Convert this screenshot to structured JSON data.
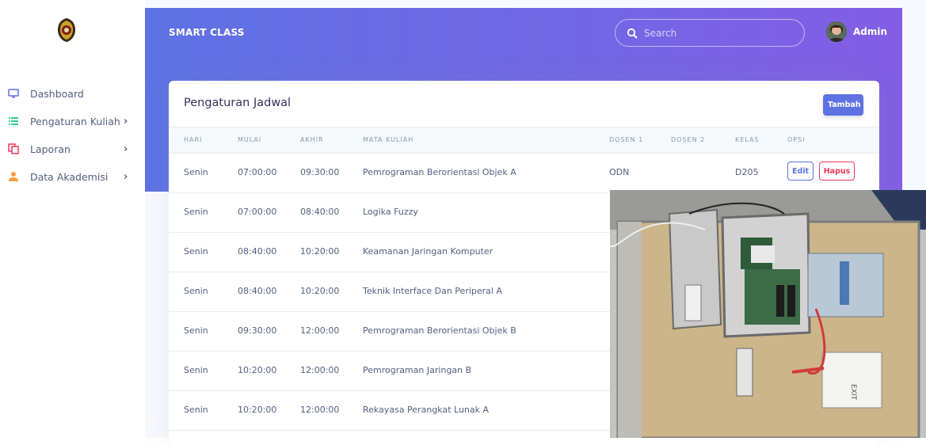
{
  "sidebar": {
    "logo": "university-crest-logo",
    "items": [
      {
        "label": "Dashboard",
        "icon": "monitor-icon",
        "color": "#5e72e4",
        "has_submenu": false
      },
      {
        "label": "Pengaturan Kuliah",
        "icon": "list-icon",
        "color": "#2dce89",
        "has_submenu": true
      },
      {
        "label": "Laporan",
        "icon": "copy-icon",
        "color": "#f5365c",
        "has_submenu": true
      },
      {
        "label": "Data Akademisi",
        "icon": "user-icon",
        "color": "#fb6340",
        "has_submenu": true
      }
    ]
  },
  "header": {
    "brand": "SMART CLASS",
    "search_placeholder": "Search",
    "user_name": "Admin"
  },
  "card": {
    "title": "Pengaturan Jadwal",
    "add_button": "Tambah",
    "columns": [
      "HARI",
      "MULAI",
      "AKHIR",
      "MATA KULIAH",
      "DOSEN 1",
      "DOSEN 2",
      "KELAS",
      "OPSI"
    ],
    "rows": [
      {
        "hari": "Senin",
        "mulai": "07:00:00",
        "akhir": "09:30:00",
        "matkul": "Pemrograman Berorientasi Objek A",
        "dosen1": "ODN",
        "dosen2": "",
        "kelas": "D205"
      },
      {
        "hari": "Senin",
        "mulai": "07:00:00",
        "akhir": "08:40:00",
        "matkul": "Logika Fuzzy",
        "dosen1": "",
        "dosen2": "",
        "kelas": ""
      },
      {
        "hari": "Senin",
        "mulai": "08:40:00",
        "akhir": "10:20:00",
        "matkul": "Keamanan Jaringan Komputer",
        "dosen1": "",
        "dosen2": "",
        "kelas": ""
      },
      {
        "hari": "Senin",
        "mulai": "08:40:00",
        "akhir": "10:20:00",
        "matkul": "Teknik Interface Dan Periperal A",
        "dosen1": "",
        "dosen2": "",
        "kelas": ""
      },
      {
        "hari": "Senin",
        "mulai": "09:30:00",
        "akhir": "12:00:00",
        "matkul": "Pemrograman Berorientasi Objek B",
        "dosen1": "",
        "dosen2": "",
        "kelas": ""
      },
      {
        "hari": "Senin",
        "mulai": "10:20:00",
        "akhir": "12:00:00",
        "matkul": "Pemrograman Jaringan B",
        "dosen1": "",
        "dosen2": "",
        "kelas": ""
      },
      {
        "hari": "Senin",
        "mulai": "10:20:00",
        "akhir": "12:00:00",
        "matkul": "Rekayasa Perangkat Lunak A",
        "dosen1": "",
        "dosen2": "",
        "kelas": ""
      }
    ],
    "edit_label": "Edit",
    "delete_label": "Hapus"
  },
  "photo": {
    "description_icon": "door-access-hardware-photo",
    "exit_button_text": "EXIT"
  },
  "colors": {
    "primary": "#5e72e4",
    "header_gradient_end": "#825ee4",
    "danger": "#f5365c"
  }
}
